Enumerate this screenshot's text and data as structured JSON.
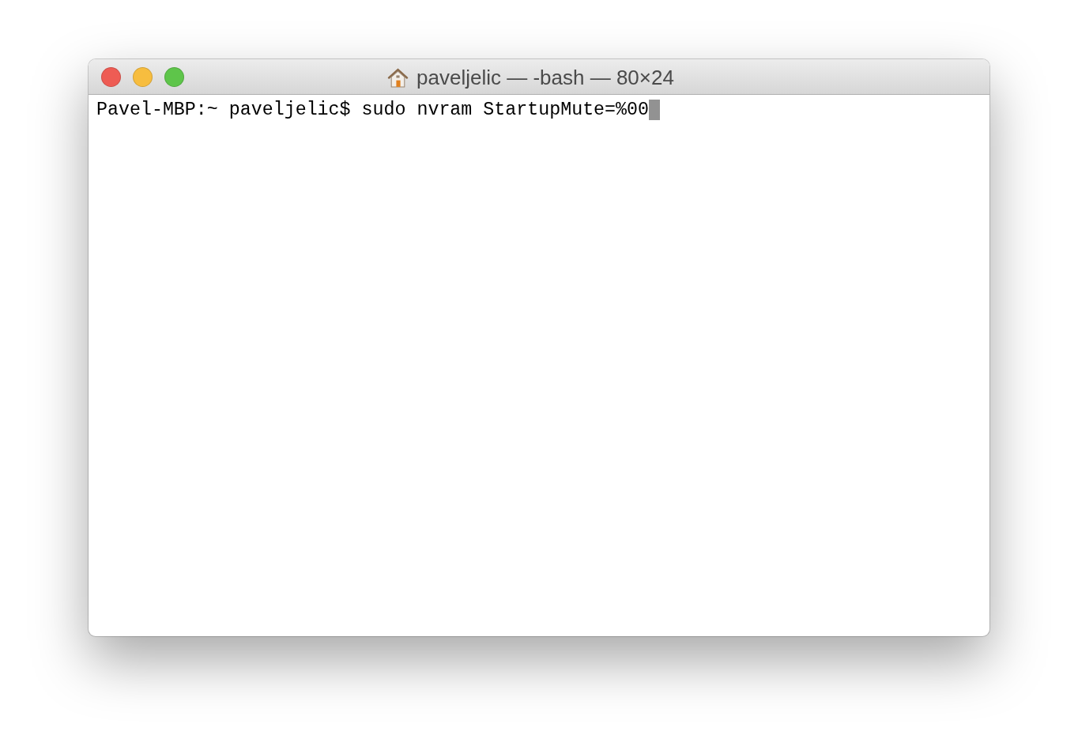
{
  "window": {
    "title": "paveljelic — -bash — 80×24"
  },
  "terminal": {
    "lines": [
      {
        "text": "Pavel-MBP:~ paveljelic$ sudo nvram StartupMute=%00",
        "cursor": true
      }
    ]
  }
}
